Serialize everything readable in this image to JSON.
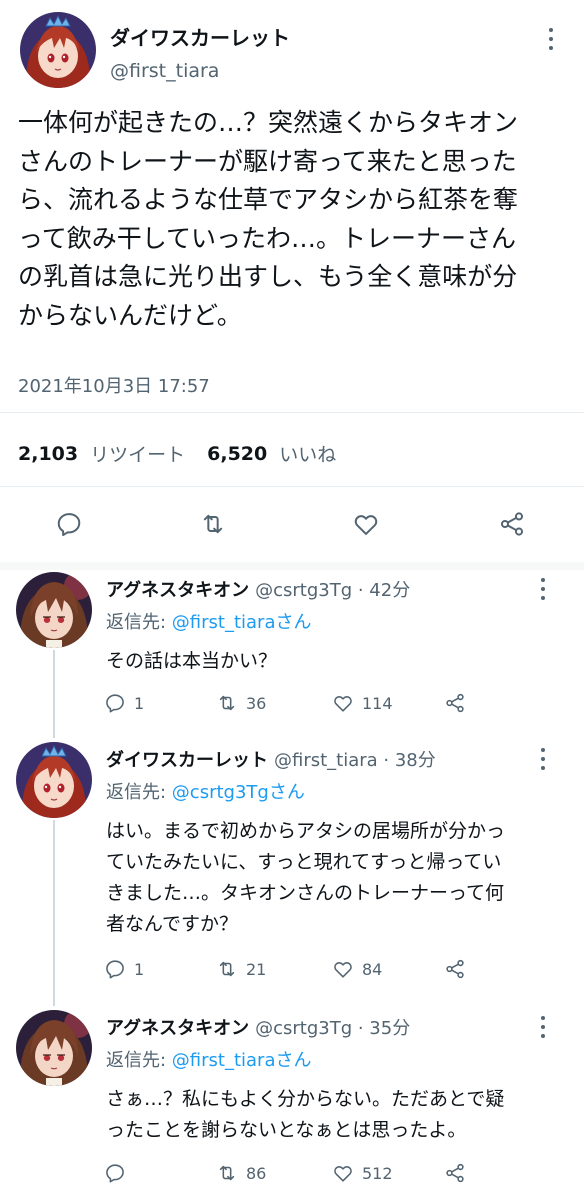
{
  "main_tweet": {
    "display_name": "ダイワスカーレット",
    "handle": "@first_tiara",
    "text_lines": [
      "一体何が起きたの…？突然遠くからタキオン",
      "さんのトレーナーが駆け寄って来たと思った",
      "ら、流れるような仕草でアタシから紅茶を奪",
      "って飲み干していったわ…。トレーナーさん",
      "の乳首は急に光り出すし、もう全く意味が分",
      "からないんだけど。"
    ],
    "timestamp": "2021年10月3日 17:57",
    "retweets": "2,103",
    "retweets_label": "リツイート",
    "likes": "6,520",
    "likes_label": "いいね",
    "avatar_icon": "character-avatar-scarlet-icon"
  },
  "replies": [
    {
      "display_name": "アグネスタキオン",
      "meta": "@csrtg3Tg · 42分",
      "reply_to_label": "返信先: ",
      "reply_to_handle": "@first_tiaraさん",
      "text_lines": [
        "その話は本当かい？"
      ],
      "reply_count": "1",
      "retweet_count": "36",
      "like_count": "114",
      "avatar_icon": "character-avatar-tachyon-icon"
    },
    {
      "display_name": "ダイワスカーレット",
      "meta": "@first_tiara · 38分",
      "reply_to_label": "返信先: ",
      "reply_to_handle": "@csrtg3Tgさん",
      "text_lines": [
        "はい。まるで初めからアタシの居場所が分かっ",
        "ていたみたいに、すっと現れてすっと帰ってい",
        "きました…。タキオンさんのトレーナーって何",
        "者なんですか？"
      ],
      "reply_count": "1",
      "retweet_count": "21",
      "like_count": "84",
      "avatar_icon": "character-avatar-scarlet-icon"
    },
    {
      "display_name": "アグネスタキオン",
      "meta": "@csrtg3Tg · 35分",
      "reply_to_label": "返信先: ",
      "reply_to_handle": "@first_tiaraさん",
      "text_lines": [
        "さぁ…？私にもよく分からない。ただあとで疑",
        "ったことを謝らないとなぁとは思ったよ。"
      ],
      "reply_count": "",
      "retweet_count": "86",
      "like_count": "512",
      "avatar_icon": "character-avatar-tachyon-icon"
    }
  ],
  "colors": {
    "text_primary": "#0f1419",
    "text_secondary": "#536471",
    "link": "#1d9bf0",
    "divider": "#e6ecf0",
    "scarlet_hair": "#9e2a1e",
    "tachyon_hair": "#6b3a24"
  }
}
